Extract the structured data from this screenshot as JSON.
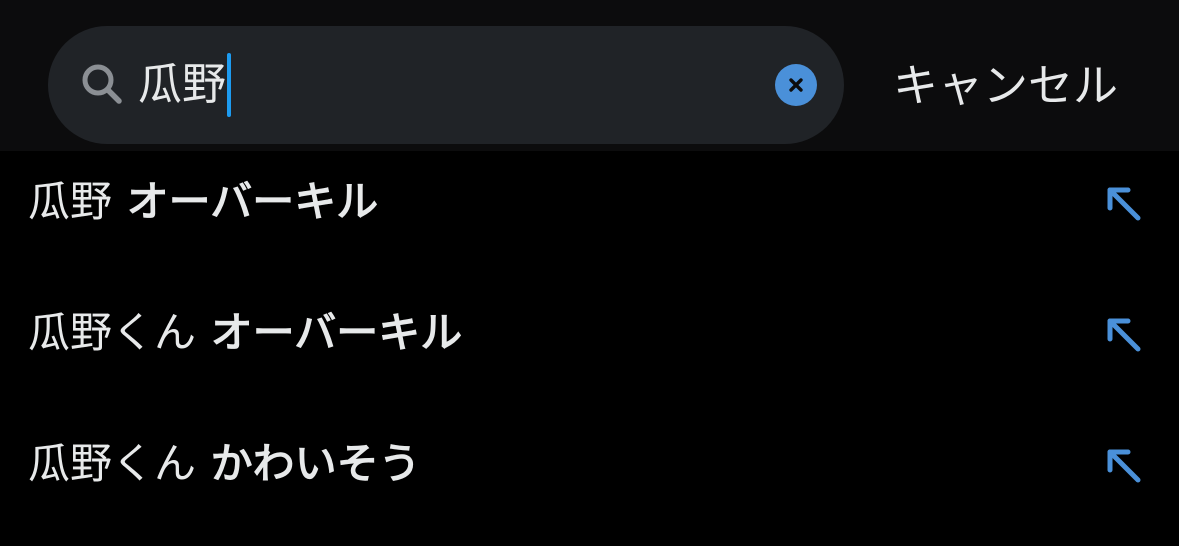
{
  "search": {
    "query": "瓜野",
    "clear_icon": "close-circle-icon",
    "search_icon": "search-icon"
  },
  "header": {
    "cancel_label": "キャンセル"
  },
  "suggestions": [
    {
      "prefix": "瓜野",
      "rest": " オーバーキル",
      "icon": "arrow-up-left-icon"
    },
    {
      "prefix": "瓜野くん",
      "rest": " オーバーキル",
      "icon": "arrow-up-left-icon"
    },
    {
      "prefix": "瓜野くん",
      "rest": " かわいそう",
      "icon": "arrow-up-left-icon"
    }
  ],
  "colors": {
    "accent": "#1d9bf0",
    "clear_button": "#4a90d9",
    "search_box": "#202327",
    "header_bg": "#0c0c0d",
    "background": "#000000",
    "text": "#e7e9ea"
  }
}
